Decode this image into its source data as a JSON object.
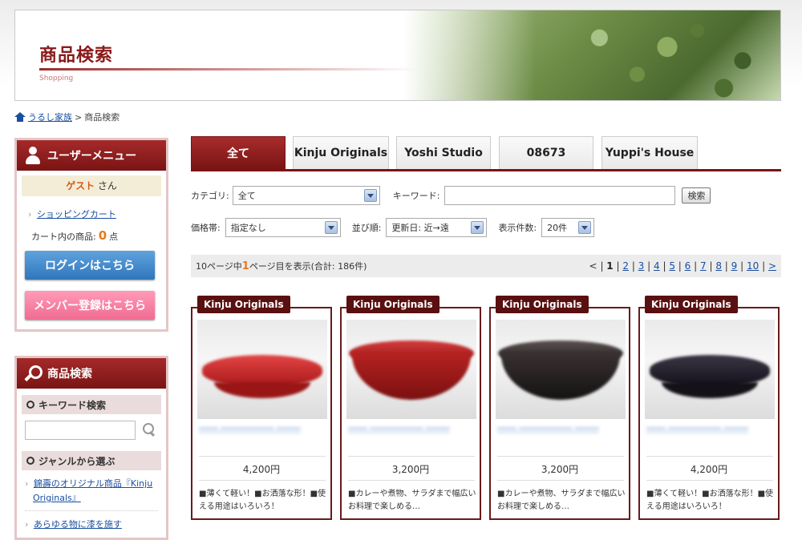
{
  "banner": {
    "title": "商品検索",
    "subtitle": "Shopping"
  },
  "breadcrumb": {
    "home": "うるし家族",
    "separator": ">",
    "current": "商品検索"
  },
  "user_menu": {
    "title": "ユーザーメニュー",
    "guest_name": "ゲスト",
    "guest_suffix": "さん",
    "cart_link": "ショッピングカート",
    "cart_count_label": "カート内の商品:",
    "cart_count": "0",
    "cart_count_unit": "点",
    "login_button": "ログインはこちら",
    "register_button": "メンバー登録はこちら"
  },
  "search_box": {
    "title": "商品検索",
    "keyword_section": "キーワード検索",
    "genre_section": "ジャンルから選ぶ",
    "genre_items": [
      "錦壽のオリジナル商品『Kinju Originals』",
      "あらゆる物に漆を施す"
    ]
  },
  "tabs": [
    "全て",
    "Kinju Originals",
    "Yoshi Studio",
    "08673",
    "Yuppi's House"
  ],
  "filters": {
    "category_label": "カテゴリ:",
    "category_value": "全て",
    "keyword_label": "キーワード:",
    "search_button": "検索",
    "price_label": "価格帯:",
    "price_value": "指定なし",
    "sort_label": "並び順:",
    "sort_value": "更新日: 近→遠",
    "count_label": "表示件数:",
    "count_value": "20件"
  },
  "pager": {
    "text_pre": "10ページ中",
    "current": "1",
    "text_post": "ページ目を表示(合計: 186件)",
    "prev": "<",
    "pages": [
      "1",
      "2",
      "3",
      "4",
      "5",
      "6",
      "7",
      "8",
      "9",
      "10"
    ],
    "next": ">"
  },
  "products": [
    {
      "shop": "Kinju Originals",
      "price": "4,200円",
      "desc": "■薄くて軽い！■お洒落な形！■使える用途はいろいろ！",
      "color": "#c42020"
    },
    {
      "shop": "Kinju Originals",
      "price": "3,200円",
      "desc": "■カレーや煮物、サラダまで幅広いお料理で楽しめる…",
      "color": "#a81c1c"
    },
    {
      "shop": "Kinju Originals",
      "price": "3,200円",
      "desc": "■カレーや煮物、サラダまで幅広いお料理で楽しめる…",
      "color": "#2a2424"
    },
    {
      "shop": "Kinju Originals",
      "price": "4,200円",
      "desc": "■薄くて軽い！■お洒落な形！■使える用途はいろいろ！",
      "color": "#1c1a22"
    }
  ]
}
